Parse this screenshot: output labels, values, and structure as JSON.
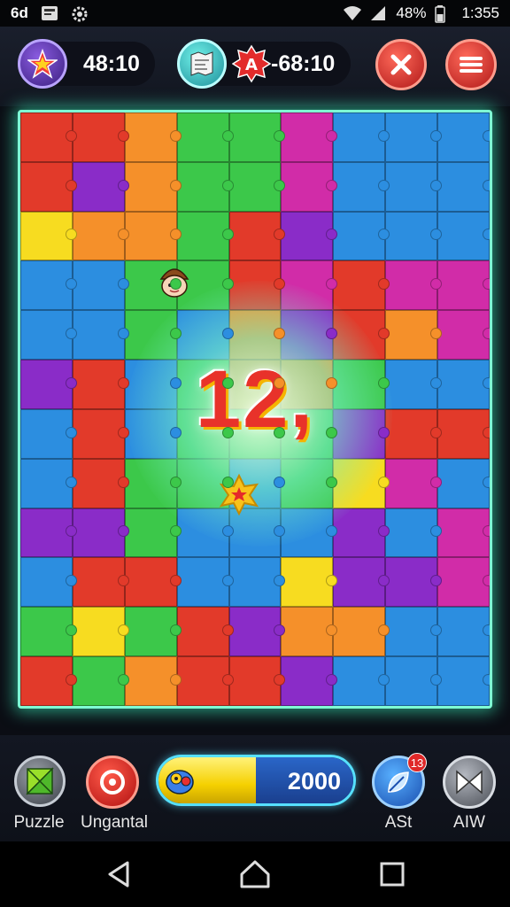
{
  "status_bar": {
    "left_text": "6d",
    "battery": "48%",
    "time": "1:355"
  },
  "top_bar": {
    "timer": "48:10",
    "score": "-68:10"
  },
  "board": {
    "center_number": "12,",
    "colors": {
      "red": "#e23a2a",
      "orange": "#f5902a",
      "yellow": "#f7dc20",
      "green": "#3cc84a",
      "blue": "#2c8ee0",
      "purple": "#8a2cc8",
      "magenta": "#d12ca8"
    },
    "rows": [
      [
        "red",
        "red",
        "orange",
        "green",
        "green",
        "magenta",
        "blue",
        "blue",
        "blue"
      ],
      [
        "red",
        "purple",
        "orange",
        "green",
        "green",
        "magenta",
        "blue",
        "blue",
        "blue"
      ],
      [
        "yellow",
        "orange",
        "orange",
        "green",
        "red",
        "purple",
        "blue",
        "blue",
        "blue"
      ],
      [
        "blue",
        "blue",
        "green",
        "green",
        "red",
        "magenta",
        "red",
        "magenta",
        "magenta"
      ],
      [
        "blue",
        "blue",
        "green",
        "blue",
        "orange",
        "purple",
        "red",
        "orange",
        "magenta"
      ],
      [
        "purple",
        "red",
        "blue",
        "green",
        "orange",
        "orange",
        "green",
        "blue",
        "blue"
      ],
      [
        "blue",
        "red",
        "blue",
        "green",
        "green",
        "green",
        "purple",
        "red",
        "red"
      ],
      [
        "blue",
        "red",
        "green",
        "green",
        "blue",
        "green",
        "yellow",
        "magenta",
        "blue"
      ],
      [
        "purple",
        "purple",
        "green",
        "blue",
        "blue",
        "blue",
        "purple",
        "blue",
        "magenta"
      ],
      [
        "blue",
        "red",
        "red",
        "blue",
        "blue",
        "yellow",
        "purple",
        "purple",
        "magenta"
      ],
      [
        "green",
        "yellow",
        "green",
        "red",
        "purple",
        "orange",
        "orange",
        "blue",
        "blue"
      ],
      [
        "red",
        "green",
        "orange",
        "red",
        "red",
        "purple",
        "blue",
        "blue",
        "blue"
      ]
    ]
  },
  "bottom_bar": {
    "puzzle_label": "Puzzle",
    "ungantal_label": "Ungantal",
    "progress_value": "2000",
    "progress_fraction": 0.5,
    "ast_label": "ASt",
    "ast_badge": "13",
    "aiw_label": "AIW"
  }
}
